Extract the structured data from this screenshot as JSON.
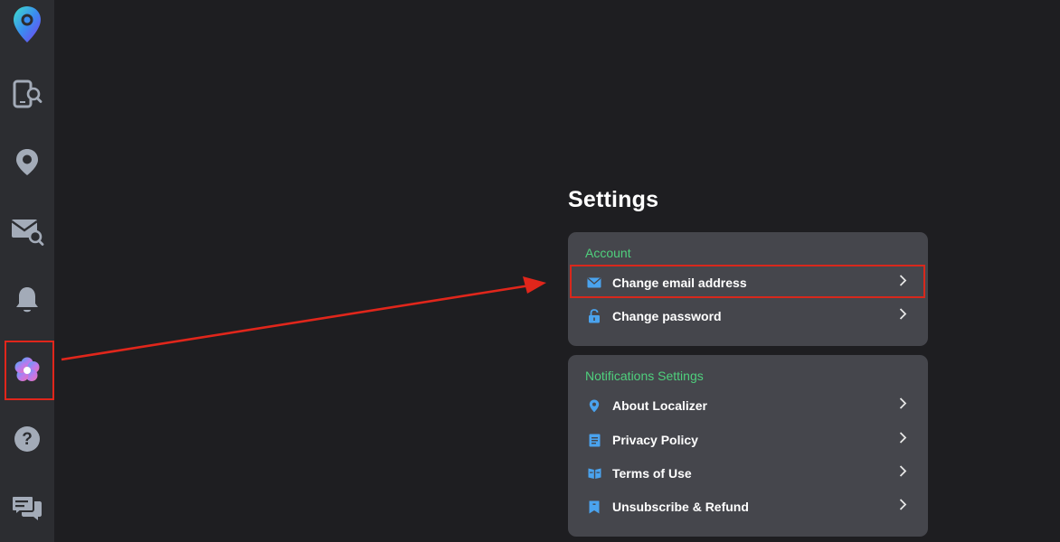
{
  "sidebar": {
    "items": [
      {
        "name": "logo",
        "icon": "location-pin-logo-icon"
      },
      {
        "name": "phone-search",
        "icon": "phone-search-icon"
      },
      {
        "name": "location",
        "icon": "location-pin-icon"
      },
      {
        "name": "email-search",
        "icon": "mail-search-icon"
      },
      {
        "name": "notifications",
        "icon": "bell-icon"
      },
      {
        "name": "settings",
        "icon": "settings-flower-icon",
        "active": true
      },
      {
        "name": "help",
        "icon": "question-icon"
      },
      {
        "name": "chat",
        "icon": "chat-icon"
      }
    ]
  },
  "page": {
    "title": "Settings"
  },
  "account": {
    "section_label": "Account",
    "items": [
      {
        "label": "Change email address",
        "icon": "mail-icon"
      },
      {
        "label": "Change password",
        "icon": "unlock-icon"
      }
    ]
  },
  "notifications": {
    "section_label": "Notifications Settings",
    "items": [
      {
        "label": "About Localizer",
        "icon": "location-pin-icon"
      },
      {
        "label": "Privacy Policy",
        "icon": "document-icon"
      },
      {
        "label": "Terms of Use",
        "icon": "book-icon"
      },
      {
        "label": "Unsubscribe & Refund",
        "icon": "bookmark-icon"
      }
    ]
  },
  "colors": {
    "background": "#1e1e21",
    "sidebar": "#2c2d31",
    "card": "#45464c",
    "section_label": "#4fd07d",
    "icon_blue": "#4aa3ee",
    "annotation_red": "#e0261b"
  }
}
